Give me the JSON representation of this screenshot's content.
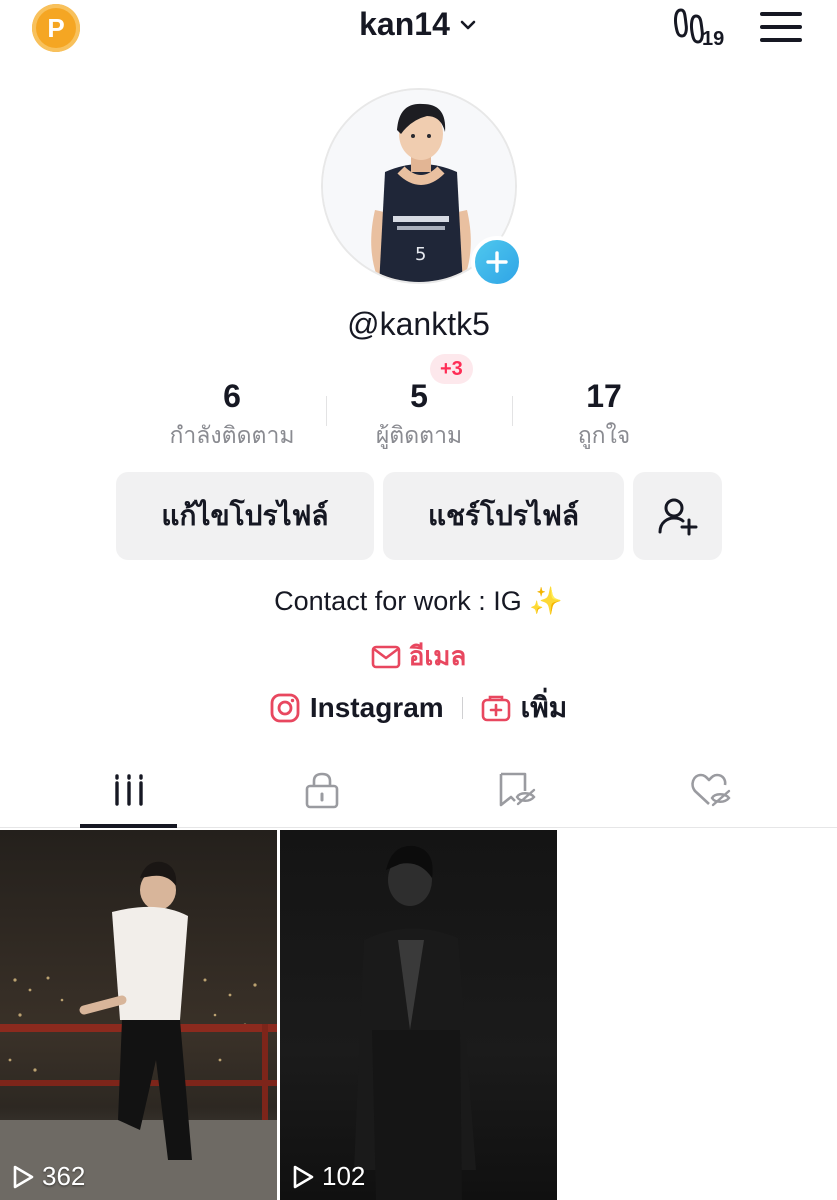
{
  "header": {
    "coin_letter": "P",
    "username": "kan14",
    "notif_count": "19"
  },
  "profile": {
    "handle": "@kanktk5",
    "stats": {
      "following": {
        "value": "6",
        "label": "กำลังติดตาม"
      },
      "followers": {
        "value": "5",
        "label": "ผู้ติดตาม",
        "new_badge": "+3"
      },
      "likes": {
        "value": "17",
        "label": "ถูกใจ"
      }
    },
    "buttons": {
      "edit": "แก้ไขโปรไฟล์",
      "share": "แชร์โปรไฟล์"
    },
    "bio": "Contact for work : IG ✨",
    "email_label": "อีเมล",
    "links": {
      "instagram": "Instagram",
      "add": "เพิ่ม"
    }
  },
  "tabs": [
    "videos-grid",
    "private",
    "reposts-hidden",
    "liked-hidden"
  ],
  "videos": [
    {
      "views": "362"
    },
    {
      "views": "102"
    }
  ],
  "colors": {
    "accent": "#fe2c55",
    "email": "#e8475f",
    "button_bg": "#f1f1f2",
    "coin": "#f5a623",
    "plus_badge": "#2fa4e6"
  }
}
